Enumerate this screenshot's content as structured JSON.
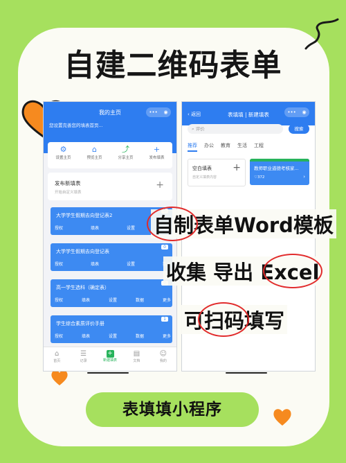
{
  "poster": {
    "title": "自建二维码表单",
    "feature_1": "自制表单Word模板",
    "feature_2": "收集 导出 Excel",
    "feature_3": "可扫码填写",
    "bottom_label": "表填填小程序"
  },
  "colors": {
    "accent": "#2e7df0",
    "card_blue": "#3d8af2",
    "bg_green": "#a6e05e",
    "highlight_red": "#e12b2b",
    "heart_orange": "#f68a1f"
  },
  "phone_home": {
    "title": "我的主页",
    "subtitle": "您设置完善您的填表首页...",
    "quick_actions": [
      {
        "label": "设置主页",
        "icon": "gear-icon",
        "glyph": "⚙"
      },
      {
        "label": "预览主页",
        "icon": "home-icon",
        "glyph": "⌂"
      },
      {
        "label": "分享主页",
        "icon": "share-icon",
        "glyph": "⤴"
      },
      {
        "label": "发布填表",
        "icon": "plus-icon",
        "glyph": "+"
      }
    ],
    "publish": {
      "title": "发布新填表",
      "hint": "开始自定义填表"
    },
    "forms": [
      {
        "title": "大学学生假期去向登记表2",
        "badge": "0"
      },
      {
        "title": "大学学生假期去向登记表",
        "badge": "0"
      },
      {
        "title": "高一学生选科（确定表）",
        "badge": "0"
      },
      {
        "title": "学生综合素质评价手册",
        "badge": "1"
      }
    ],
    "form_actions": [
      "授权",
      "填表",
      "设置",
      "数据",
      "更多"
    ],
    "tabs": [
      {
        "label": "首页",
        "glyph": "⌂"
      },
      {
        "label": "记录",
        "glyph": "☰"
      },
      {
        "label": "新建填表",
        "glyph": "+"
      },
      {
        "label": "文档",
        "glyph": "▤"
      },
      {
        "label": "我的",
        "glyph": "☺"
      }
    ]
  },
  "phone_new": {
    "back": "返回",
    "title": "表填填 | 新建填表",
    "search_placeholder": "评价",
    "search_button": "搜索",
    "tabs": [
      "推荐",
      "办公",
      "教育",
      "生活",
      "工程"
    ],
    "blank": {
      "title": "空白填表",
      "hint": "自定义填表内容"
    },
    "template": {
      "title": "教师职业道德考核家...",
      "count": "372"
    }
  }
}
